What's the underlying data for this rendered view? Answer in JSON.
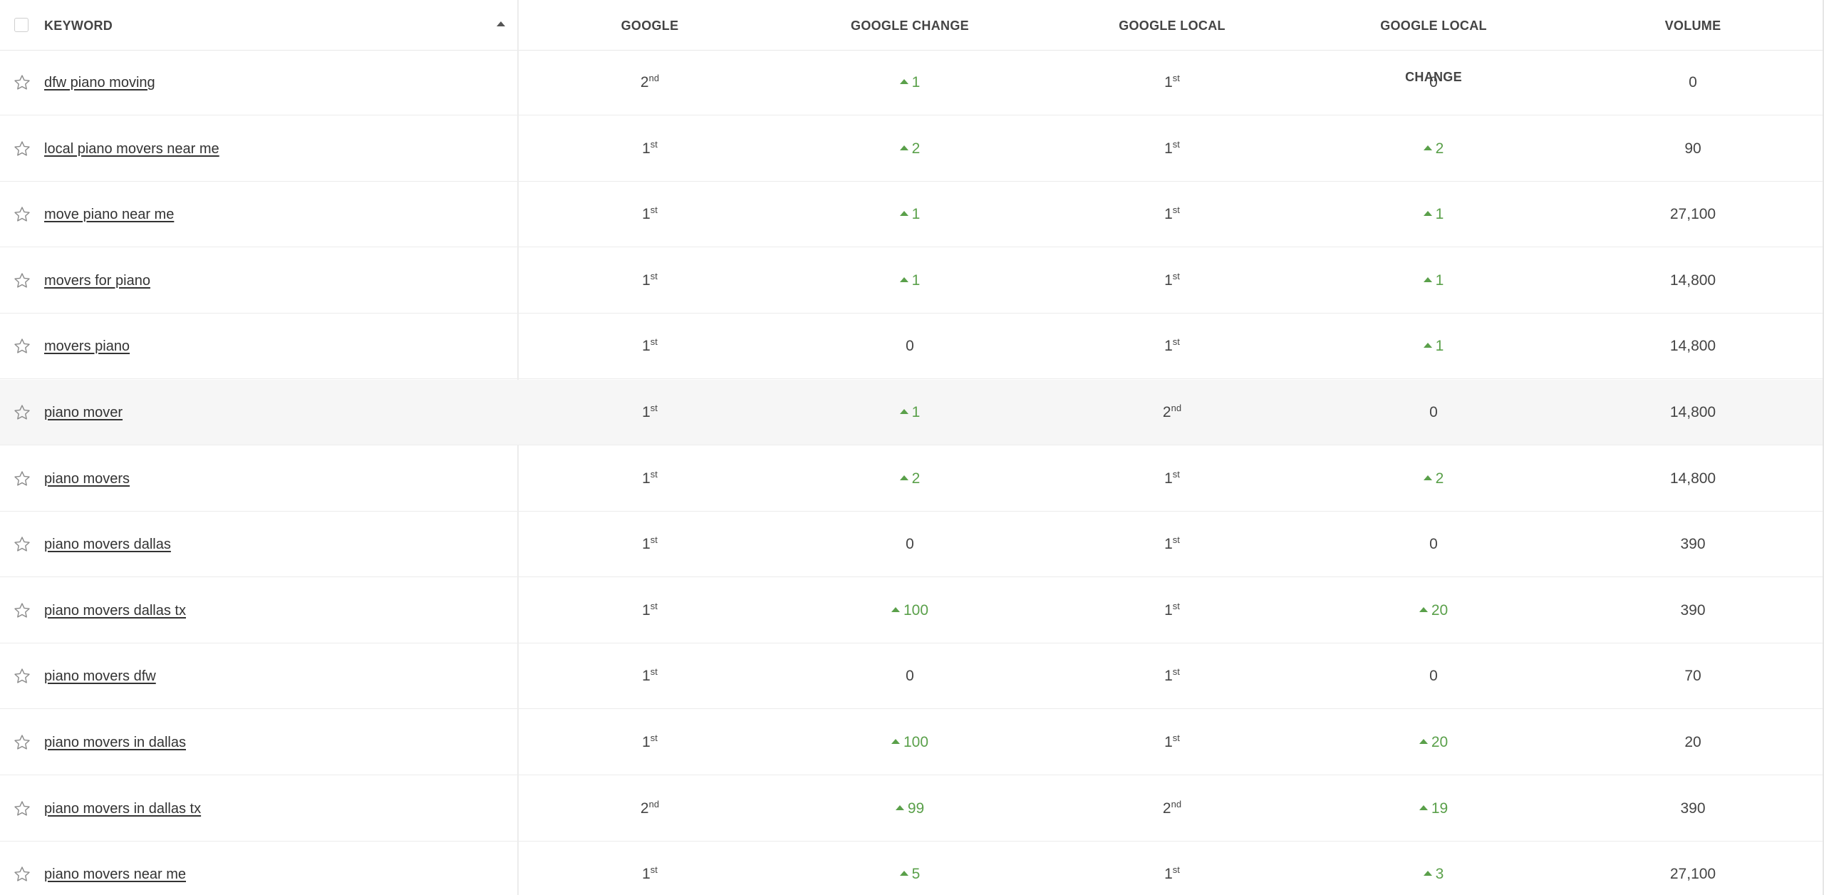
{
  "columns": {
    "keyword": "KEYWORD",
    "google": "GOOGLE",
    "google_change": "GOOGLE CHANGE",
    "google_local": "GOOGLE LOCAL",
    "google_local_change": "GOOGLE LOCAL CHANGE",
    "volume": "VOLUME"
  },
  "sort": {
    "column": "keyword",
    "direction": "ascending"
  },
  "colors": {
    "positive": "#5aa04a",
    "text": "#333333",
    "highlight_row": "#f6f6f6"
  },
  "rows": [
    {
      "keyword": "dfw piano moving",
      "google": {
        "n": "2",
        "suf": "nd"
      },
      "google_change": {
        "dir": "up",
        "val": "1"
      },
      "google_local": {
        "n": "1",
        "suf": "st"
      },
      "google_local_change": {
        "dir": "none",
        "val": "0"
      },
      "volume": "0"
    },
    {
      "keyword": "local piano movers near me",
      "google": {
        "n": "1",
        "suf": "st"
      },
      "google_change": {
        "dir": "up",
        "val": "2"
      },
      "google_local": {
        "n": "1",
        "suf": "st"
      },
      "google_local_change": {
        "dir": "up",
        "val": "2"
      },
      "volume": "90"
    },
    {
      "keyword": "move piano near me",
      "google": {
        "n": "1",
        "suf": "st"
      },
      "google_change": {
        "dir": "up",
        "val": "1"
      },
      "google_local": {
        "n": "1",
        "suf": "st"
      },
      "google_local_change": {
        "dir": "up",
        "val": "1"
      },
      "volume": "27,100"
    },
    {
      "keyword": "movers for piano",
      "google": {
        "n": "1",
        "suf": "st"
      },
      "google_change": {
        "dir": "up",
        "val": "1"
      },
      "google_local": {
        "n": "1",
        "suf": "st"
      },
      "google_local_change": {
        "dir": "up",
        "val": "1"
      },
      "volume": "14,800"
    },
    {
      "keyword": "movers piano",
      "google": {
        "n": "1",
        "suf": "st"
      },
      "google_change": {
        "dir": "none",
        "val": "0"
      },
      "google_local": {
        "n": "1",
        "suf": "st"
      },
      "google_local_change": {
        "dir": "up",
        "val": "1"
      },
      "volume": "14,800"
    },
    {
      "keyword": "piano mover",
      "google": {
        "n": "1",
        "suf": "st"
      },
      "google_change": {
        "dir": "up",
        "val": "1"
      },
      "google_local": {
        "n": "2",
        "suf": "nd"
      },
      "google_local_change": {
        "dir": "none",
        "val": "0"
      },
      "volume": "14,800",
      "highlighted": true
    },
    {
      "keyword": "piano movers",
      "google": {
        "n": "1",
        "suf": "st"
      },
      "google_change": {
        "dir": "up",
        "val": "2"
      },
      "google_local": {
        "n": "1",
        "suf": "st"
      },
      "google_local_change": {
        "dir": "up",
        "val": "2"
      },
      "volume": "14,800"
    },
    {
      "keyword": "piano movers dallas",
      "google": {
        "n": "1",
        "suf": "st"
      },
      "google_change": {
        "dir": "none",
        "val": "0"
      },
      "google_local": {
        "n": "1",
        "suf": "st"
      },
      "google_local_change": {
        "dir": "none",
        "val": "0"
      },
      "volume": "390"
    },
    {
      "keyword": "piano movers dallas tx",
      "google": {
        "n": "1",
        "suf": "st"
      },
      "google_change": {
        "dir": "up",
        "val": "100"
      },
      "google_local": {
        "n": "1",
        "suf": "st"
      },
      "google_local_change": {
        "dir": "up",
        "val": "20"
      },
      "volume": "390"
    },
    {
      "keyword": "piano movers dfw",
      "google": {
        "n": "1",
        "suf": "st"
      },
      "google_change": {
        "dir": "none",
        "val": "0"
      },
      "google_local": {
        "n": "1",
        "suf": "st"
      },
      "google_local_change": {
        "dir": "none",
        "val": "0"
      },
      "volume": "70"
    },
    {
      "keyword": "piano movers in dallas",
      "google": {
        "n": "1",
        "suf": "st"
      },
      "google_change": {
        "dir": "up",
        "val": "100"
      },
      "google_local": {
        "n": "1",
        "suf": "st"
      },
      "google_local_change": {
        "dir": "up",
        "val": "20"
      },
      "volume": "20"
    },
    {
      "keyword": "piano movers in dallas tx",
      "google": {
        "n": "2",
        "suf": "nd"
      },
      "google_change": {
        "dir": "up",
        "val": "99"
      },
      "google_local": {
        "n": "2",
        "suf": "nd"
      },
      "google_local_change": {
        "dir": "up",
        "val": "19"
      },
      "volume": "390"
    },
    {
      "keyword": "piano movers near me",
      "google": {
        "n": "1",
        "suf": "st"
      },
      "google_change": {
        "dir": "up",
        "val": "5"
      },
      "google_local": {
        "n": "1",
        "suf": "st"
      },
      "google_local_change": {
        "dir": "up",
        "val": "3"
      },
      "volume": "27,100"
    }
  ]
}
